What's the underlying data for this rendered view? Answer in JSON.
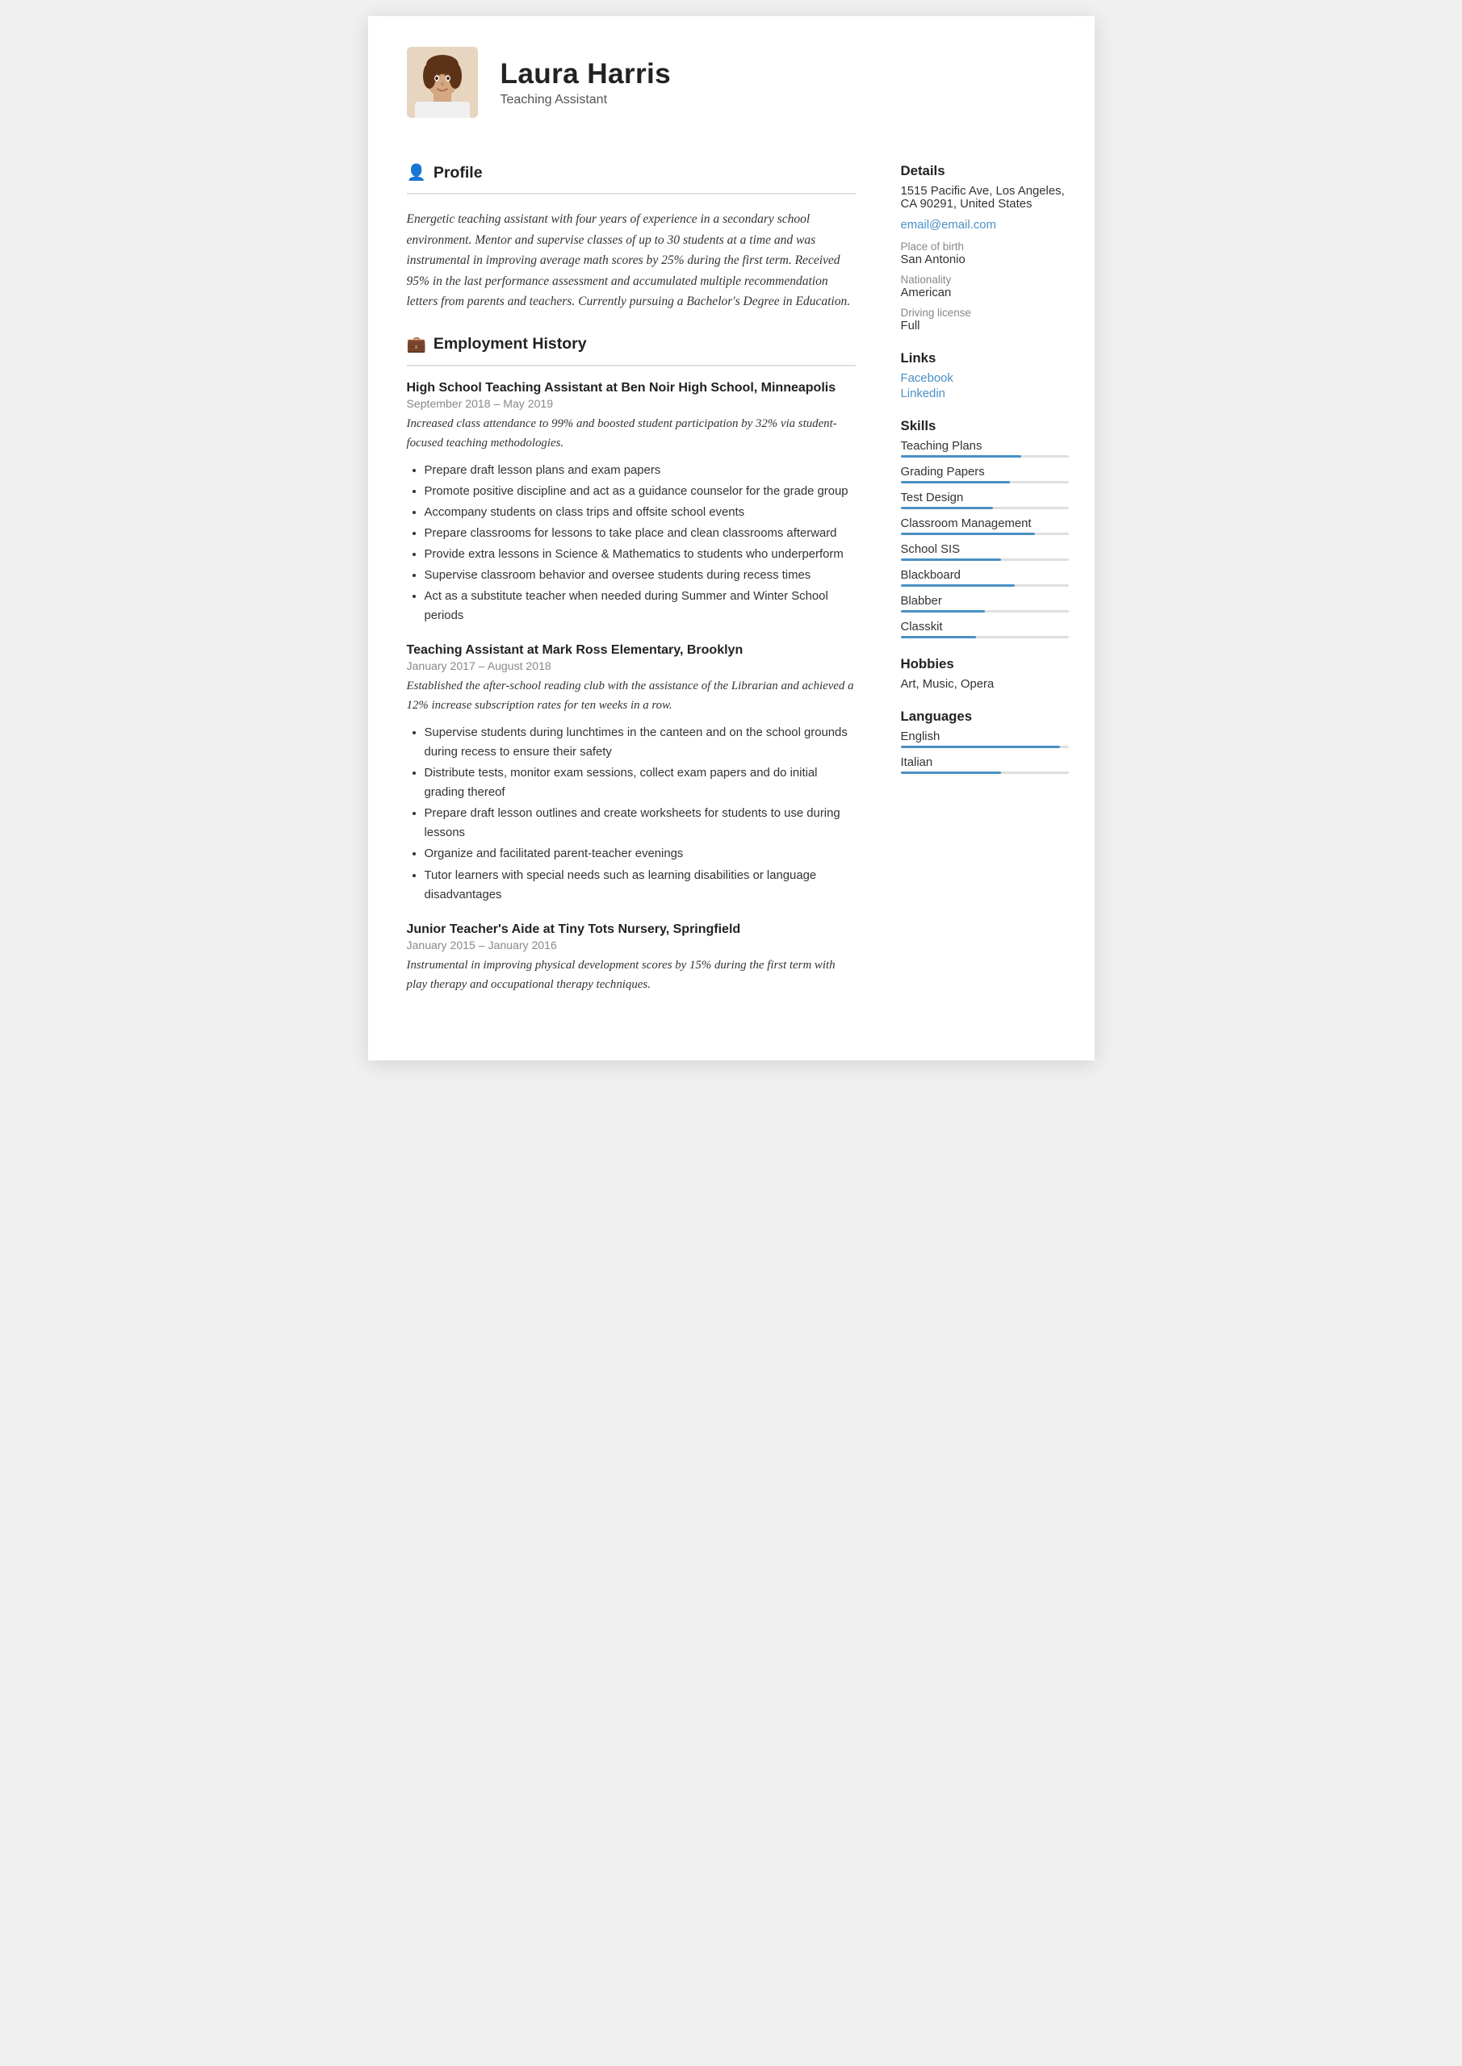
{
  "header": {
    "name": "Laura Harris",
    "title": "Teaching Assistant"
  },
  "profile": {
    "heading": "Profile",
    "text": "Energetic teaching assistant with four years of experience in a secondary school environment. Mentor and supervise classes of up to 30 students at a time and was instrumental in improving average math scores by 25% during the first term. Received 95% in the last performance assessment and accumulated multiple recommendation letters from parents and teachers. Currently pursuing a Bachelor's Degree in Education."
  },
  "employment": {
    "heading": "Employment History",
    "jobs": [
      {
        "title": "High School Teaching Assistant at Ben Noir High School, Minneapolis",
        "dates": "September 2018  –  May 2019",
        "summary": "Increased class attendance to 99% and boosted student participation by 32% via student-focused teaching methodologies.",
        "bullets": [
          "Prepare draft lesson plans and exam papers",
          "Promote positive discipline and act as a guidance counselor for the grade group",
          "Accompany students on class trips and offsite school events",
          "Prepare classrooms for lessons to take place and clean classrooms afterward",
          "Provide extra lessons in Science & Mathematics to students who underperform",
          "Supervise classroom behavior and oversee students during recess times",
          "Act as a substitute teacher when needed during Summer and Winter School periods"
        ]
      },
      {
        "title": "Teaching Assistant at Mark Ross Elementary, Brooklyn",
        "dates": "January 2017  –  August 2018",
        "summary": "Established the after-school reading club with the assistance of the Librarian and achieved a 12% increase subscription rates for ten weeks in a row.",
        "bullets": [
          "Supervise students during lunchtimes in the canteen and on the school grounds during recess to ensure their safety",
          "Distribute tests, monitor exam sessions, collect exam papers and do initial grading thereof",
          "Prepare draft lesson outlines and create worksheets for students to use during lessons",
          "Organize and facilitated parent-teacher evenings",
          "Tutor learners with special needs such as learning disabilities or language disadvantages"
        ]
      },
      {
        "title": "Junior Teacher's Aide at Tiny Tots Nursery, Springfield",
        "dates": "January 2015  –  January 2016",
        "summary": "Instrumental in improving physical development scores by 15% during the first term with play therapy and occupational therapy techniques.",
        "bullets": []
      }
    ]
  },
  "details": {
    "heading": "Details",
    "address": "1515 Pacific Ave, Los Angeles, CA 90291, United States",
    "email": "email@email.com",
    "place_of_birth_label": "Place of birth",
    "place_of_birth": "San Antonio",
    "nationality_label": "Nationality",
    "nationality": "American",
    "driving_license_label": "Driving license",
    "driving_license": "Full"
  },
  "links": {
    "heading": "Links",
    "items": [
      {
        "label": "Facebook",
        "url": "#"
      },
      {
        "label": "Linkedin",
        "url": "#"
      }
    ]
  },
  "skills": {
    "heading": "Skills",
    "items": [
      {
        "name": "Teaching Plans",
        "percent": 72
      },
      {
        "name": "Grading Papers",
        "percent": 65
      },
      {
        "name": "Test Design",
        "percent": 55
      },
      {
        "name": "Classroom Management",
        "percent": 80
      },
      {
        "name": "School SIS",
        "percent": 60
      },
      {
        "name": "Blackboard",
        "percent": 68
      },
      {
        "name": "Blabber",
        "percent": 50
      },
      {
        "name": "Classkit",
        "percent": 45
      }
    ]
  },
  "hobbies": {
    "heading": "Hobbies",
    "text": "Art, Music, Opera"
  },
  "languages": {
    "heading": "Languages",
    "items": [
      {
        "name": "English",
        "percent": 95
      },
      {
        "name": "Italian",
        "percent": 60
      }
    ]
  }
}
